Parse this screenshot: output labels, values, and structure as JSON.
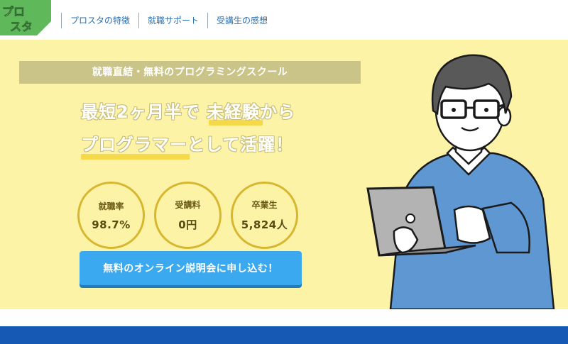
{
  "logo": {
    "line1": "プロ",
    "line2": "スタ"
  },
  "nav": {
    "items": [
      {
        "label": "プロスタの特徴"
      },
      {
        "label": "就職サポート"
      },
      {
        "label": "受講生の感想"
      }
    ]
  },
  "hero": {
    "tagline": "就職直結・無料のプログラミングスクール",
    "headline_line1": "最短2ヶ月半で 未経験から",
    "headline_line2": "プログラマーとして活躍！",
    "stats": [
      {
        "label": "就職率",
        "value": "98.7%"
      },
      {
        "label": "受講料",
        "value": "0円"
      },
      {
        "label": "卒業生",
        "value": "5,824人"
      }
    ],
    "cta_label": "無料のオンライン説明会に申し込む！"
  },
  "colors": {
    "hero_bg": "#fdf3a7",
    "cta": "#3aa9ef",
    "accent_underline": "#f5d94a",
    "logo_green": "#5fb85a",
    "footer": "#1659b5"
  }
}
